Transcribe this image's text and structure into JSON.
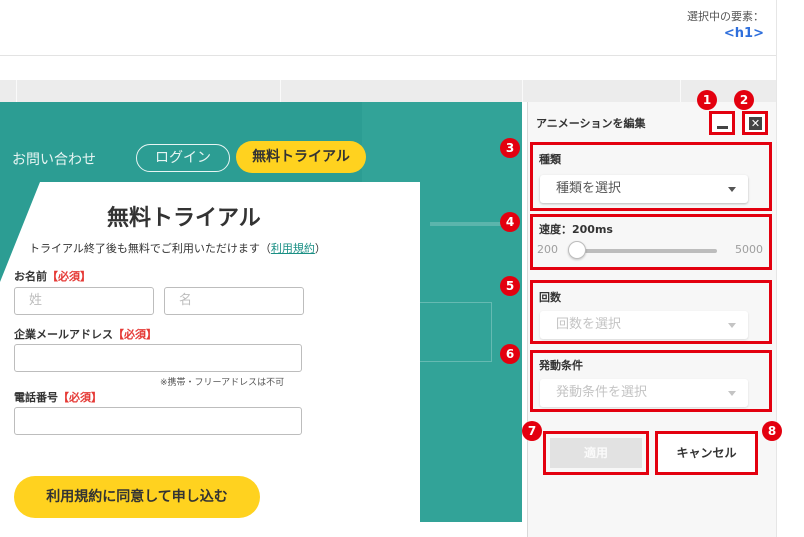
{
  "header": {
    "selected_label": "選択中の要素：",
    "selected_value": "<h1>"
  },
  "preview": {
    "nav_contact": "お問い合わせ",
    "nav_login": "ログイン",
    "nav_trial": "無料トライアル",
    "form_title": "無料トライアル",
    "form_subtitle_before": "トライアル終了後も無料でご利用いただけます（",
    "form_subtitle_link": "利用規約",
    "form_subtitle_after": "）",
    "name_label": "お名前",
    "required_mark": "【必須】",
    "last_name_placeholder": "姓",
    "first_name_placeholder": "名",
    "email_label": "企業メールアドレス",
    "email_note": "※携帯・フリーアドレスは不可",
    "phone_label": "電話番号",
    "submit_label": "利用規約に同意して申し込む"
  },
  "panel": {
    "title": "アニメーションを編集",
    "type_label": "種類",
    "type_placeholder": "種類を選択",
    "speed_label": "速度：200ms",
    "speed_min": "200",
    "speed_max": "5000",
    "speed_value": 200,
    "count_label": "回数",
    "count_placeholder": "回数を選択",
    "trigger_label": "発動条件",
    "trigger_placeholder": "発動条件を選択",
    "apply_label": "適用",
    "cancel_label": "キャンセル"
  },
  "badges": [
    "1",
    "2",
    "3",
    "4",
    "5",
    "6",
    "7",
    "8"
  ],
  "colors": {
    "teal": "#2c9d93",
    "yellow": "#ffd21f",
    "highlight_red": "#e3000f",
    "link_blue": "#2f6fdc"
  }
}
